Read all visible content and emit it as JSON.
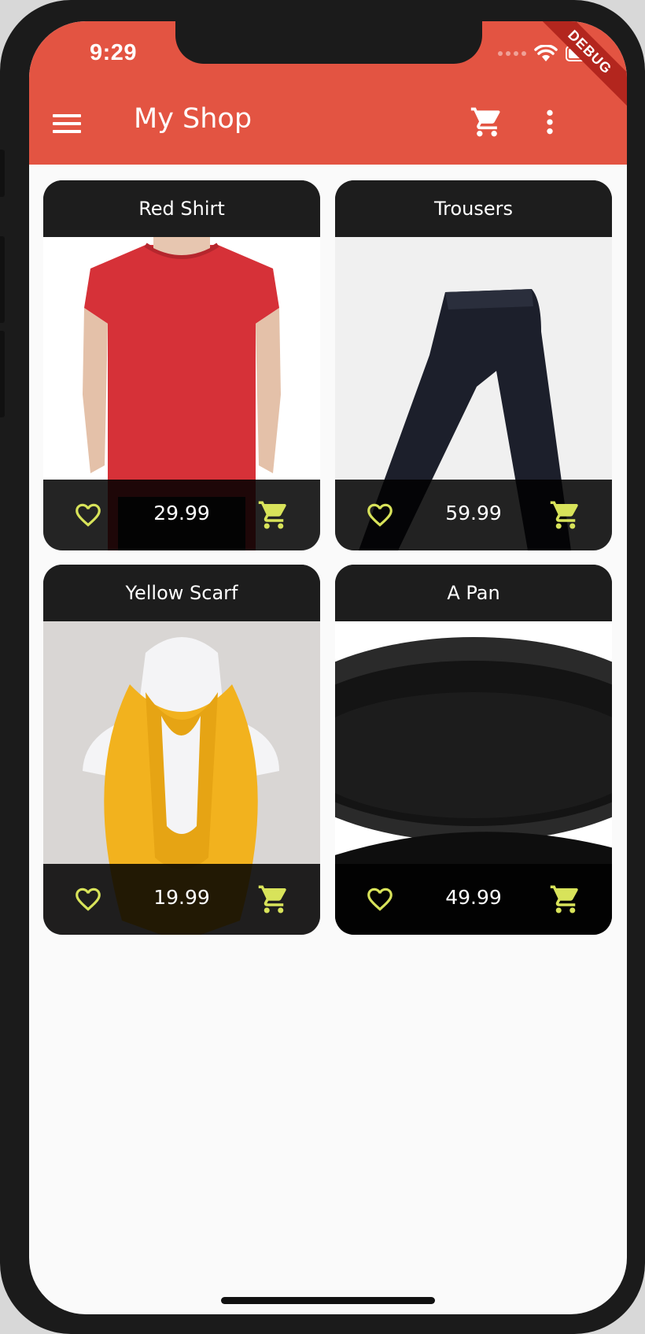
{
  "status_bar": {
    "time": "9:29",
    "debug_banner": "DEBUG"
  },
  "app_bar": {
    "title": "My Shop",
    "background": "#e35442"
  },
  "accent_color": "#d8e35a",
  "products": [
    {
      "name": "Red Shirt",
      "price": "29.99",
      "image": "red-shirt"
    },
    {
      "name": "Trousers",
      "price": "59.99",
      "image": "trousers"
    },
    {
      "name": "Yellow Scarf",
      "price": "19.99",
      "image": "yellow-scarf"
    },
    {
      "name": "A Pan",
      "price": "49.99",
      "image": "pan"
    }
  ],
  "icons": {
    "menu": "menu-icon",
    "cart": "shopping-cart-icon",
    "more": "more-vert-icon",
    "favorite": "heart-outline-icon"
  }
}
